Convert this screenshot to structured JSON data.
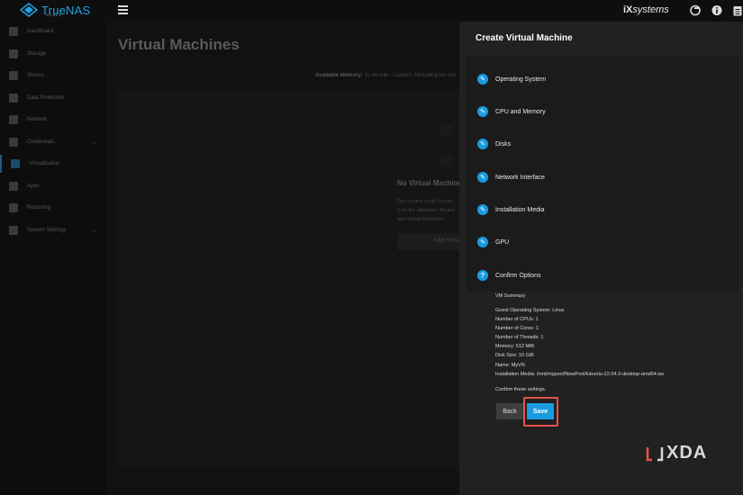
{
  "header": {
    "logo_text": "TrueNAS",
    "logo_sub": "SCALE",
    "brand_prefix": "iX",
    "brand_suffix": "systems"
  },
  "sidebar": {
    "items": [
      {
        "label": "Dashboard",
        "icon": "dashboard-icon"
      },
      {
        "label": "Storage",
        "icon": "storage-icon"
      },
      {
        "label": "Shares",
        "icon": "shares-icon"
      },
      {
        "label": "Data Protection",
        "icon": "shield-icon"
      },
      {
        "label": "Network",
        "icon": "network-icon"
      },
      {
        "label": "Credentials",
        "icon": "key-icon",
        "chevron": "›"
      },
      {
        "label": "Virtualization",
        "icon": "monitor-icon",
        "active": true
      },
      {
        "label": "Apps",
        "icon": "apps-icon"
      },
      {
        "label": "Reporting",
        "icon": "chart-icon"
      },
      {
        "label": "System Settings",
        "icon": "gear-icon",
        "chevron": "›"
      }
    ]
  },
  "main": {
    "title": "Virtual Machines",
    "available_label": "Available Memory:",
    "available_value": "11.94 GiB - Caution: Allocating too mu",
    "empty_title": "No Virtual Machines",
    "empty_desc": "The system could not retr from the database. Please add Virtual Machines",
    "empty_button": "Add Virtu"
  },
  "panel": {
    "title": "Create Virtual Machine",
    "steps": [
      {
        "label": "Operating System",
        "icon": "pencil-icon",
        "glyph": "✎"
      },
      {
        "label": "CPU and Memory",
        "icon": "pencil-icon",
        "glyph": "✎"
      },
      {
        "label": "Disks",
        "icon": "pencil-icon",
        "glyph": "✎"
      },
      {
        "label": "Network Interface",
        "icon": "pencil-icon",
        "glyph": "✎"
      },
      {
        "label": "Installation Media",
        "icon": "pencil-icon",
        "glyph": "✎"
      },
      {
        "label": "GPU",
        "icon": "pencil-icon",
        "glyph": "✎"
      },
      {
        "label": "Confirm Options",
        "icon": "help-icon",
        "glyph": "?"
      }
    ],
    "summary_title": "VM Summary",
    "summary_lines": [
      "Guest Operating System: Linux",
      "Number of CPUs: 1",
      "Number of Cores: 1",
      "Number of Threads: 1",
      "Memory: 512 MiB",
      "Disk Size: 10 GiB",
      "Name: MyVN",
      "Installation Media: /mnt/mypool/NewPool/lubuntu-22.04.3-desktop-amd64.iso"
    ],
    "confirm_text": "Confirm these settings.",
    "back_label": "Back",
    "save_label": "Save"
  },
  "watermark": {
    "text": "XDA"
  },
  "colors": {
    "accent": "#1a9be0",
    "highlight": "#e8524a",
    "panel": "#212121"
  }
}
